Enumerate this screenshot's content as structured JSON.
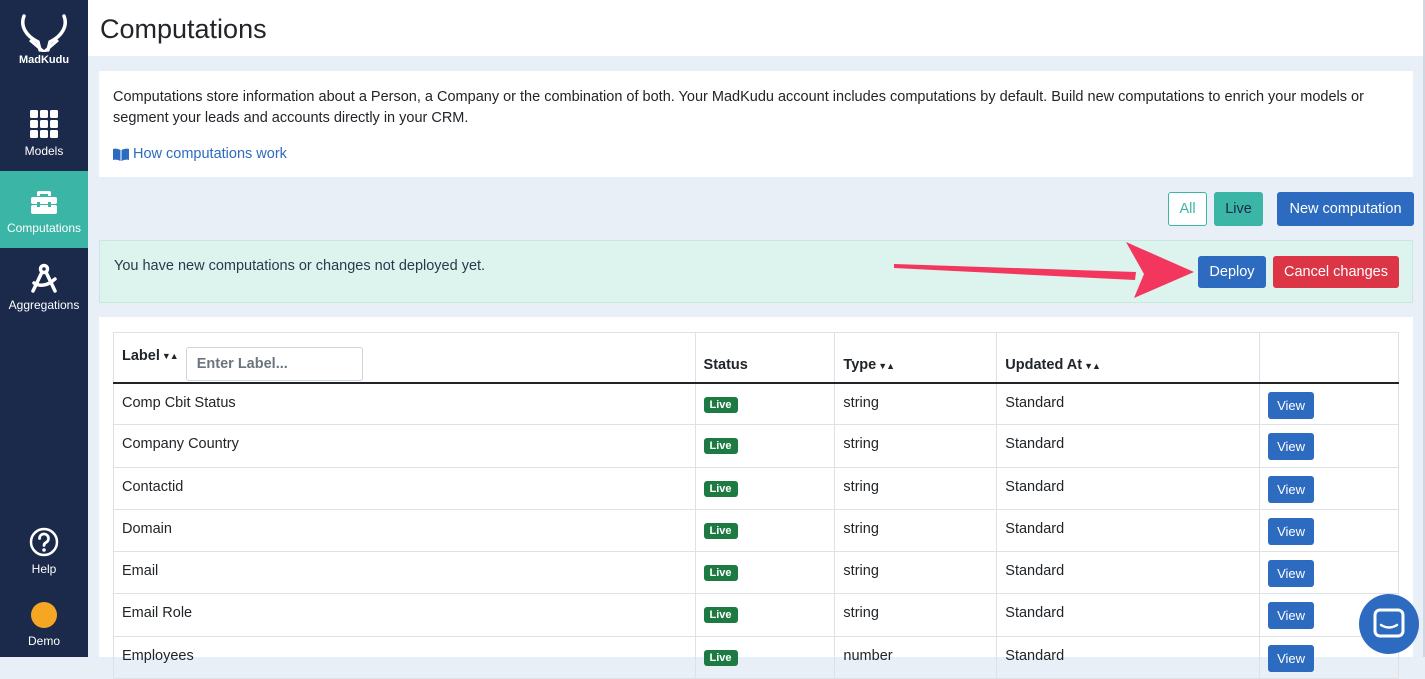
{
  "sidebar": {
    "brand": "MadKudu",
    "items": [
      {
        "label": "Models",
        "icon": "grid-icon"
      },
      {
        "label": "Computations",
        "icon": "toolbox-icon"
      },
      {
        "label": "Aggregations",
        "icon": "compass-icon"
      }
    ],
    "help": {
      "label": "Help",
      "icon": "question-icon"
    },
    "user": {
      "label": "Demo"
    }
  },
  "header": {
    "title": "Computations"
  },
  "info": {
    "description": "Computations store information about a Person, a Company or the combination of both. Your MadKudu account includes computations by default. Build new computations to enrich your models or segment your leads and accounts directly in your CRM.",
    "link": "How computations work"
  },
  "filters": {
    "all": "All",
    "live": "Live",
    "new_button": "New computation"
  },
  "alert": {
    "message": "You have new computations or changes not deployed yet.",
    "deploy": "Deploy",
    "cancel": "Cancel changes"
  },
  "table": {
    "columns": {
      "label": "Label",
      "status": "Status",
      "type": "Type",
      "updated": "Updated At"
    },
    "label_placeholder": "Enter Label...",
    "view_label": "View",
    "rows": [
      {
        "label": "Comp Cbit Status",
        "status": "Live",
        "type": "string",
        "updated": "Standard"
      },
      {
        "label": "Company Country",
        "status": "Live",
        "type": "string",
        "updated": "Standard"
      },
      {
        "label": "Contactid",
        "status": "Live",
        "type": "string",
        "updated": "Standard"
      },
      {
        "label": "Domain",
        "status": "Live",
        "type": "string",
        "updated": "Standard"
      },
      {
        "label": "Email",
        "status": "Live",
        "type": "string",
        "updated": "Standard"
      },
      {
        "label": "Email Role",
        "status": "Live",
        "type": "string",
        "updated": "Standard"
      },
      {
        "label": "Employees",
        "status": "Live",
        "type": "number",
        "updated": "Standard"
      }
    ]
  },
  "colors": {
    "sidebar": "#1b2a4a",
    "accent": "#3bb5a6",
    "primary": "#2c6bbf",
    "danger": "#dc3545",
    "arrow": "#f2365e"
  }
}
